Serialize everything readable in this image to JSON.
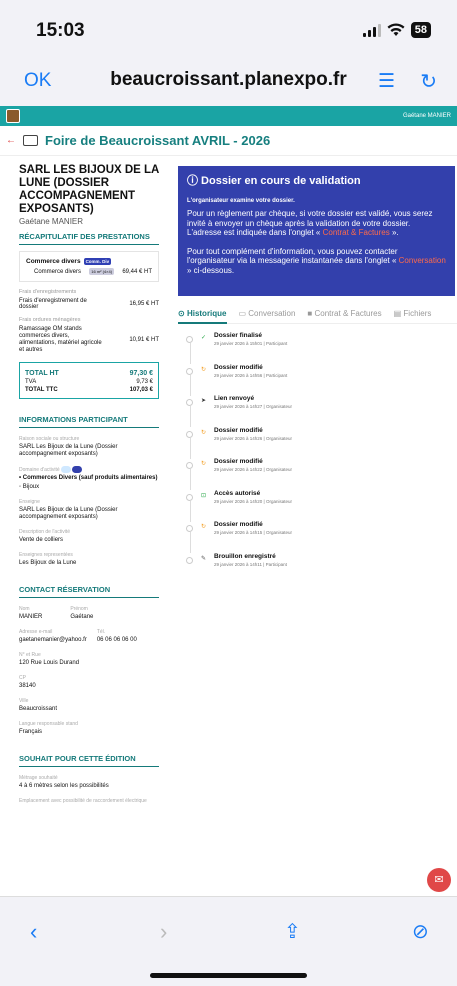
{
  "status": {
    "time": "15:03",
    "battery": "58"
  },
  "browser": {
    "done": "OK",
    "url": "beaucroissant.planexpo.fr"
  },
  "site": {
    "user": "Gaétane MANIER",
    "fair_title": "Foire de Beaucroissant AVRIL - 2026"
  },
  "company": {
    "name": "SARL LES BIJOUX DE LA LUNE (DOSSIER ACCOMPAGNEMENT EXPOSANTS)",
    "person": "Gaétane MANIER"
  },
  "recap": {
    "title": "RÉCAPITULATIF DES PRESTATIONS",
    "category": "Commerce divers",
    "category_badge": "Comm. Div",
    "line1": {
      "label": "Commerce divers",
      "tag": "16 m² (4×4)",
      "price": "69,44 € HT"
    },
    "reg_label": "Frais d'enregistrements",
    "reg_item": "Frais d'enregistrement de dossier",
    "reg_price": "16,95 € HT",
    "waste_label": "Frais ordures ménagères",
    "waste_item": "Ramassage OM stands commerces divers, alimentations, matériel agricole et autres",
    "waste_price": "10,91 € HT",
    "total_ht_label": "TOTAL HT",
    "total_ht": "97,30 €",
    "tva_label": "TVA",
    "tva": "9,73 €",
    "total_ttc_label": "TOTAL TTC",
    "total_ttc": "107,03 €"
  },
  "participant": {
    "title": "INFORMATIONS PARTICIPANT",
    "raison_label": "Raison sociale ou structure",
    "raison": "SARL Les Bijoux de la Lune (Dossier accompagnement exposants)",
    "domaine_label": "Domaine d'activité",
    "domaine1": "• Commerces Divers (sauf produits alimentaires)",
    "domaine2": "◦ Bijoux",
    "enseigne_label": "Enseigne",
    "enseigne": "SARL Les Bijoux de la Lune (Dossier accompagnement exposants)",
    "desc_label": "Description de l'activité",
    "desc": "Vente de colliers",
    "repr_label": "Enseignes representées",
    "repr": "Les Bijoux de la Lune"
  },
  "contact": {
    "title": "CONTACT RÉSERVATION",
    "nom_label": "Nom",
    "nom": "MANIER",
    "prenom_label": "Prénom",
    "prenom": "Gaétane",
    "email_label": "Adresse e-mail",
    "email": "gaetanemanier@yahoo.fr",
    "tel_label": "Tél.",
    "tel": "06 06 06 06 00",
    "rue_label": "N° et Rue",
    "rue": "120 Rue Louis Durand",
    "cp_label": "CP",
    "cp": "38140",
    "ville_label": "Ville",
    "ville": "Beaucroissant",
    "lang_label": "Langue responsable stand",
    "lang": "Français"
  },
  "souhait": {
    "title": "SOUHAIT POUR CETTE ÉDITION",
    "metrage_label": "Métrage souhaité",
    "metrage": "4 à 6 mètres selon les possibilités",
    "empl_label": "Emplacement avec possibilité de raccordement électrique"
  },
  "alert": {
    "title": "ⓘ Dossier en cours de validation",
    "sub": "L'organisateur examine votre dossier.",
    "p1a": "Pour un règlement par chèque, si votre dossier est validé, vous serez invité à envoyer un chèque après la validation de votre dossier. L'adresse est indiquée dans l'onglet « ",
    "p1link": "Contrat & Factures",
    "p1b": " ».",
    "p2a": "Pour tout complément d'information, vous pouvez contacter l'organisateur via la messagerie instantanée dans l'onglet « ",
    "p2link": "Conversation",
    "p2b": " » ci-dessous."
  },
  "tabs": [
    "Historique",
    "Conversation",
    "Contrat & Factures",
    "Fichiers"
  ],
  "history": [
    {
      "icon": "✓",
      "color": "#2aa84a",
      "title": "Dossier finalisé",
      "date": "29 janvier 2026 à 15h01",
      "who": "Participant"
    },
    {
      "icon": "↻",
      "color": "#f29b1d",
      "title": "Dossier modifié",
      "date": "29 janvier 2026 à 14h56",
      "who": "Participant"
    },
    {
      "icon": "➤",
      "color": "#333",
      "title": "Lien renvoyé",
      "date": "29 janvier 2026 à 14h27",
      "who": "Organisateur"
    },
    {
      "icon": "↻",
      "color": "#f29b1d",
      "title": "Dossier modifié",
      "date": "29 janvier 2026 à 14h26",
      "who": "Organisateur"
    },
    {
      "icon": "↻",
      "color": "#f29b1d",
      "title": "Dossier modifié",
      "date": "29 janvier 2026 à 14h22",
      "who": "Organisateur"
    },
    {
      "icon": "⊡",
      "color": "#2aa84a",
      "title": "Accès autorisé",
      "date": "29 janvier 2026 à 14h20",
      "who": "Organisateur"
    },
    {
      "icon": "↻",
      "color": "#f29b1d",
      "title": "Dossier modifié",
      "date": "29 janvier 2026 à 14h15",
      "who": "Organisateur"
    },
    {
      "icon": "✎",
      "color": "#555",
      "title": "Brouillon enregistré",
      "date": "29 janvier 2026 à 14h11",
      "who": "Participant"
    }
  ],
  "colors": {
    "teal": "#157a7a",
    "navy": "#3340ac",
    "accent": "#1a7cf5",
    "red": "#e04848"
  }
}
